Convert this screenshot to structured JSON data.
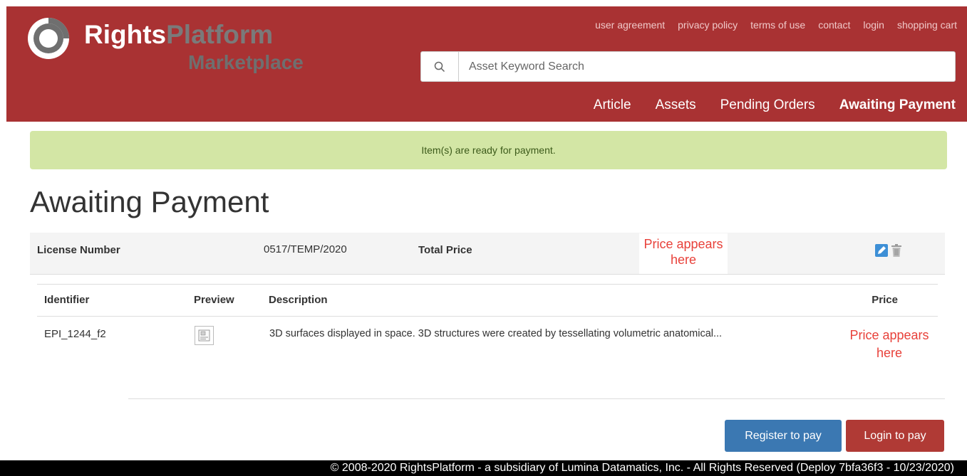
{
  "header": {
    "logo_rights": "Rights",
    "logo_platform": "Platform",
    "logo_marketplace": "Marketplace",
    "top_links": [
      "user agreement",
      "privacy policy",
      "terms of use",
      "contact",
      "login",
      "shopping cart"
    ],
    "search_placeholder": "Asset Keyword Search",
    "nav": [
      "Article",
      "Assets",
      "Pending Orders",
      "Awaiting Payment"
    ],
    "nav_active": "Awaiting Payment"
  },
  "alert": {
    "text": "Item(s) are ready for payment."
  },
  "page": {
    "title": "Awaiting Payment"
  },
  "license": {
    "number_label": "License Number",
    "number_value": "0517/TEMP/2020",
    "total_label": "Total Price",
    "total_value": "Price appears here"
  },
  "items": {
    "headers": {
      "identifier": "Identifier",
      "preview": "Preview",
      "description": "Description",
      "price": "Price"
    },
    "rows": [
      {
        "identifier": "EPI_1244_f2",
        "description": "3D surfaces displayed in space. 3D structures were created by tessellating volumetric anatomical...",
        "price": "Price appears here"
      }
    ]
  },
  "actions": {
    "register": "Register to pay",
    "login": "Login to pay"
  },
  "footer": {
    "text": "© 2008-2020 RightsPlatform - a subsidiary of Lumina Datamatics, Inc. - All Rights Reserved (Deploy 7bfa36f3 - 10/23/2020)"
  },
  "colors": {
    "header_bg": "#a93233",
    "alert_bg": "#d3e6a5",
    "price_red": "#e8413a",
    "register_blue": "#3b78b2",
    "login_red": "#b03a35"
  },
  "icons": {
    "search": "search-icon",
    "edit": "edit-icon",
    "delete": "trash-icon",
    "preview": "image-placeholder-icon"
  }
}
